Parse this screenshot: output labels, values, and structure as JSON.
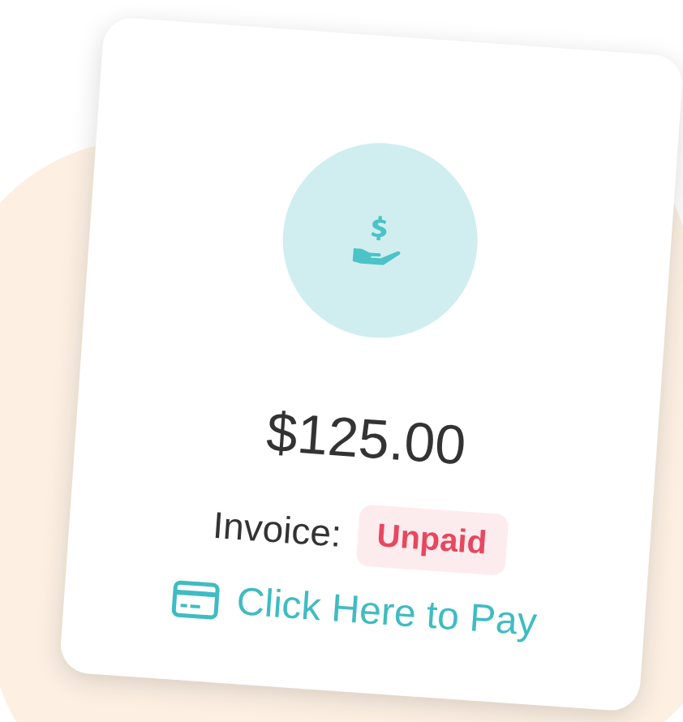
{
  "invoice": {
    "amount": "$125.00",
    "label": "Invoice:",
    "status": "Unpaid",
    "paid": false,
    "pay_link": "Click Here to Pay"
  }
}
